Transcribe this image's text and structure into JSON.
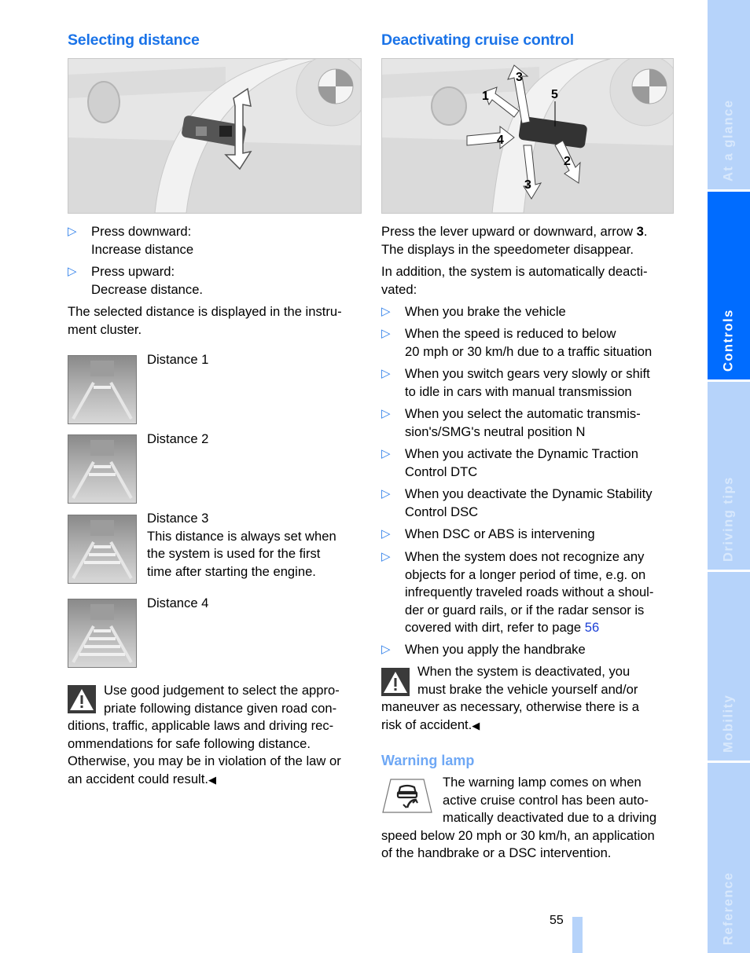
{
  "page_number": "55",
  "colors": {
    "heading": "#1a73e8",
    "subheading": "#6fa8f5",
    "bullet": "#2b7de9",
    "link": "#1a3fd6",
    "sidebar_active": "#006cff",
    "sidebar_inactive": "#b6d3fa"
  },
  "sidebar": {
    "tabs": [
      {
        "label": "At a glance",
        "active": false
      },
      {
        "label": "Controls",
        "active": true
      },
      {
        "label": "Driving tips",
        "active": false
      },
      {
        "label": "Mobility",
        "active": false
      },
      {
        "label": "Reference",
        "active": false
      }
    ]
  },
  "left": {
    "heading": "Selecting distance",
    "figure_alt": "Cruise control lever with up/down arrow",
    "bullets": [
      {
        "line1": "Press downward:",
        "line2": "Increase distance"
      },
      {
        "line1": "Press upward:",
        "line2": "Decrease distance."
      }
    ],
    "paragraph": [
      "The selected distance is displayed in the instru-",
      "ment cluster."
    ],
    "distances": [
      {
        "label": "Distance 1",
        "bars": 1,
        "note": []
      },
      {
        "label": "Distance 2",
        "bars": 2,
        "note": []
      },
      {
        "label": "Distance 3",
        "bars": 3,
        "note": [
          "This distance is always set when",
          "the system is used for the first",
          "time after starting the engine."
        ]
      },
      {
        "label": "Distance 4",
        "bars": 4,
        "note": []
      }
    ],
    "warning": [
      "Use good judgement to select the appro-",
      "priate following distance given road con-",
      "ditions, traffic, applicable laws and driving rec-",
      "ommendations for safe following distance.",
      "Otherwise, you may be in violation of the law or",
      "an accident could result."
    ],
    "end_mark": "◀"
  },
  "right": {
    "heading": "Deactivating cruise control",
    "figure_alt": "Cruise control lever with arrows 1-5",
    "figure_labels": [
      "1",
      "2",
      "3",
      "4",
      "5"
    ],
    "intro": {
      "line1_pre": "Press the lever upward or downward, arrow ",
      "line1_bold": "3",
      "line1_post": ".",
      "line2": "The displays in the speedometer disappear."
    },
    "auto": [
      "In addition, the system is automatically deacti-",
      "vated:"
    ],
    "bullets": [
      [
        "When you brake the vehicle"
      ],
      [
        "When the speed is reduced to below",
        "20 mph or 30 km/h due to a traffic situation"
      ],
      [
        "When you switch gears very slowly or shift",
        "to idle in cars with manual transmission"
      ],
      [
        "When you select the automatic transmis-",
        "sion's/SMG's neutral position N"
      ],
      [
        "When you activate the Dynamic Traction",
        "Control DTC"
      ],
      [
        "When you deactivate the Dynamic Stability",
        "Control DSC"
      ],
      [
        "When DSC or ABS is intervening"
      ],
      [
        "When the system does not recognize any",
        "objects for a longer period of time, e.g. on",
        "infrequently traveled roads without a shoul-",
        "der or guard rails, or if the radar sensor is",
        "covered with dirt, refer to page "
      ],
      [
        "When you apply the handbrake"
      ]
    ],
    "page_ref": "56",
    "warning": [
      "When the system is deactivated, you",
      "must brake the vehicle yourself and/or",
      "maneuver as necessary, otherwise there is a",
      "risk of accident."
    ],
    "end_mark": "◀",
    "lamp_heading": "Warning lamp",
    "lamp_text": [
      "The warning lamp comes on when",
      "active cruise control has been auto-",
      "matically deactivated due to a driving",
      "speed below 20 mph or 30 km/h, an application",
      "of the handbrake or a DSC intervention."
    ]
  }
}
